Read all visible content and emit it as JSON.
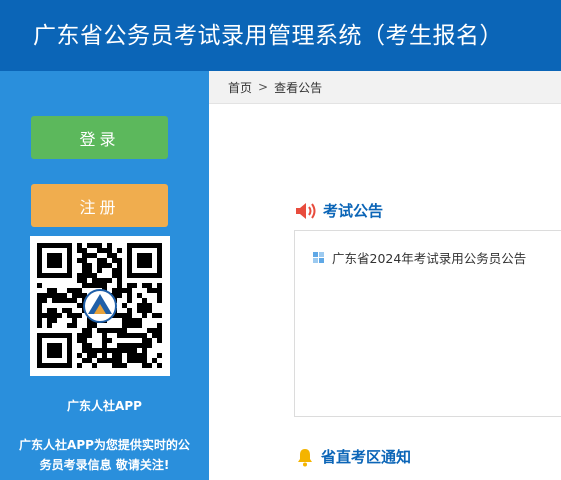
{
  "header": {
    "title": "广东省公务员考试录用管理系统（考生报名）"
  },
  "sidebar": {
    "login_label": "登录",
    "register_label": "注册",
    "qr_icon": "qr-code-icon",
    "app_name": "广东人社APP",
    "app_desc_line1": "广东人社APP为您提供实时的公",
    "app_desc_line2": "务员考录信息 敬请关注!"
  },
  "breadcrumb": {
    "home": "首页",
    "separator": ">",
    "current": "查看公告"
  },
  "sections": {
    "exam_notice": {
      "title": "考试公告",
      "icon": "speaker-icon",
      "icon_color": "#e84c3d",
      "items": [
        {
          "title": "广东省2024年考试录用公务员公告",
          "icon": "grid-bullet-icon"
        }
      ]
    },
    "province_notice": {
      "title": "省直考区通知",
      "icon": "bell-icon",
      "icon_color": "#f4b400"
    }
  },
  "colors": {
    "header_bg": "#0b65b7",
    "sidebar_bg": "#2a8fdc",
    "login_btn": "#5cb85c",
    "register_btn": "#f0ad4e",
    "section_title": "#0b65b7"
  }
}
